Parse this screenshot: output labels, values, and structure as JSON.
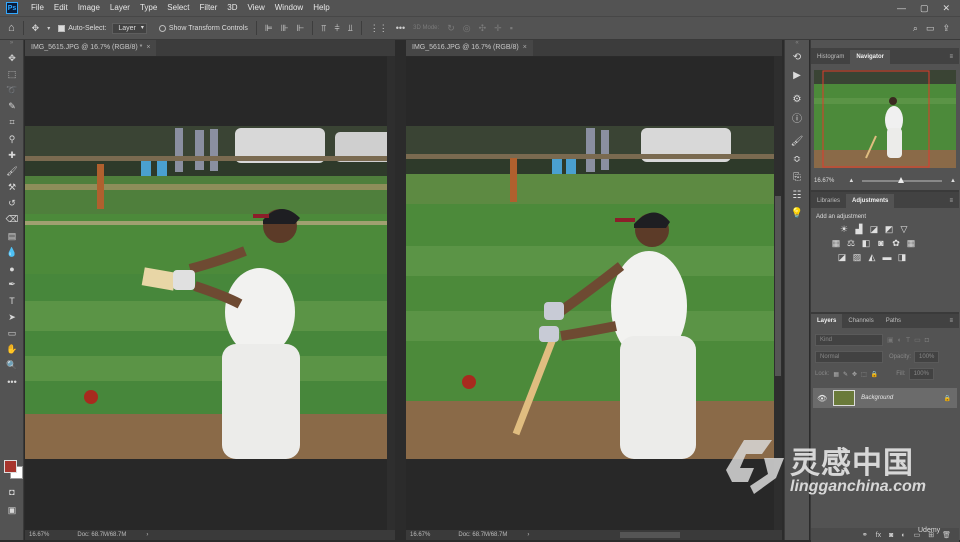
{
  "app": {
    "logo": "Ps"
  },
  "menu": [
    "File",
    "Edit",
    "Image",
    "Layer",
    "Type",
    "Select",
    "Filter",
    "3D",
    "View",
    "Window",
    "Help"
  ],
  "window_controls": [
    "—",
    "▢",
    "✕"
  ],
  "options_bar": {
    "auto_select_label": "Auto-Select:",
    "auto_select_value": "Layer",
    "transform_label": "Show Transform Controls",
    "mode_3d": "3D Mode:"
  },
  "documents": [
    {
      "tab": "IMG_5615.JPG @ 16.7% (RGB/8) *",
      "zoom": "16.67%",
      "doc_size": "Doc: 68.7M/68.7M"
    },
    {
      "tab": "IMG_5616.JPG @ 16.7% (RGB/8)",
      "zoom": "16.67%",
      "doc_size": "Doc: 68.7M/68.7M"
    }
  ],
  "top_panel": {
    "tabs": [
      "Histogram",
      "Navigator"
    ],
    "active": "Navigator",
    "zoom": "16.67%"
  },
  "adjust_panel": {
    "tabs": [
      "Libraries",
      "Adjustments"
    ],
    "active": "Adjustments",
    "hint": "Add an adjustment"
  },
  "layers_panel": {
    "tabs": [
      "Layers",
      "Channels",
      "Paths"
    ],
    "active": "Layers",
    "filter_placeholder": "Kind",
    "blend_mode": "Normal",
    "opacity_label": "Opacity:",
    "opacity_value": "100%",
    "lock_label": "Lock:",
    "fill_label": "Fill:",
    "fill_value": "100%",
    "layer_name": "Background"
  },
  "watermark": {
    "cn": "灵感中国",
    "url": "lingganchina.com"
  },
  "udemy": "Udemy"
}
